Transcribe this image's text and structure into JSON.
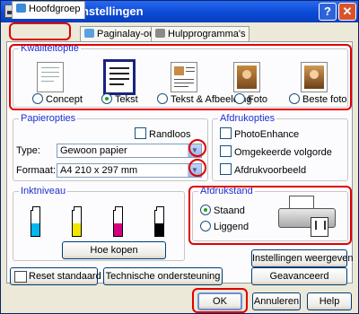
{
  "window": {
    "title": "Voorkeursinstellingen",
    "help_glyph": "?",
    "close_glyph": "✕"
  },
  "tabs": [
    {
      "label": "Hoofdgroep",
      "active": true
    },
    {
      "label": "Paginalay-out",
      "active": false
    },
    {
      "label": "Hulpprogramma's",
      "active": false
    }
  ],
  "quality": {
    "title": "Kwaliteitoptie",
    "options": [
      {
        "label": "Concept",
        "selected": false
      },
      {
        "label": "Tekst",
        "selected": true
      },
      {
        "label": "Tekst & Afbeelding",
        "selected": false
      },
      {
        "label": "Foto",
        "selected": false
      },
      {
        "label": "Beste foto",
        "selected": false
      }
    ]
  },
  "paper": {
    "title": "Papieropties",
    "borderless_label": "Randloos",
    "type_label": "Type:",
    "type_value": "Gewoon papier",
    "format_label": "Formaat:",
    "format_value": "A4 210 x 297 mm"
  },
  "print_options": {
    "title": "Afdrukopties",
    "items": [
      "PhotoEnhance",
      "Omgekeerde volgorde",
      "Afdrukvoorbeeld"
    ]
  },
  "ink": {
    "title": "Inktniveau",
    "cartridges": [
      {
        "color": "#00b7ef",
        "level": 0.5
      },
      {
        "color": "#f2e600",
        "level": 0.5
      },
      {
        "color": "#d4007f",
        "level": 0.5
      },
      {
        "color": "#000000",
        "level": 0.5
      }
    ],
    "buy_button": "Hoe kopen"
  },
  "orientation": {
    "title": "Afdrukstand",
    "options": [
      {
        "label": "Staand",
        "selected": true
      },
      {
        "label": "Liggend",
        "selected": false
      }
    ]
  },
  "buttons": {
    "show_settings": "Instellingen weergeven",
    "advanced": "Geavanceerd",
    "reset": "Reset standaard",
    "support": "Technische ondersteuning",
    "ok": "OK",
    "cancel": "Annuleren",
    "help": "Help"
  },
  "colors": {
    "highlight": "#e00000",
    "group_label": "#1f2fd0",
    "title_bar": "#0b49d6"
  }
}
